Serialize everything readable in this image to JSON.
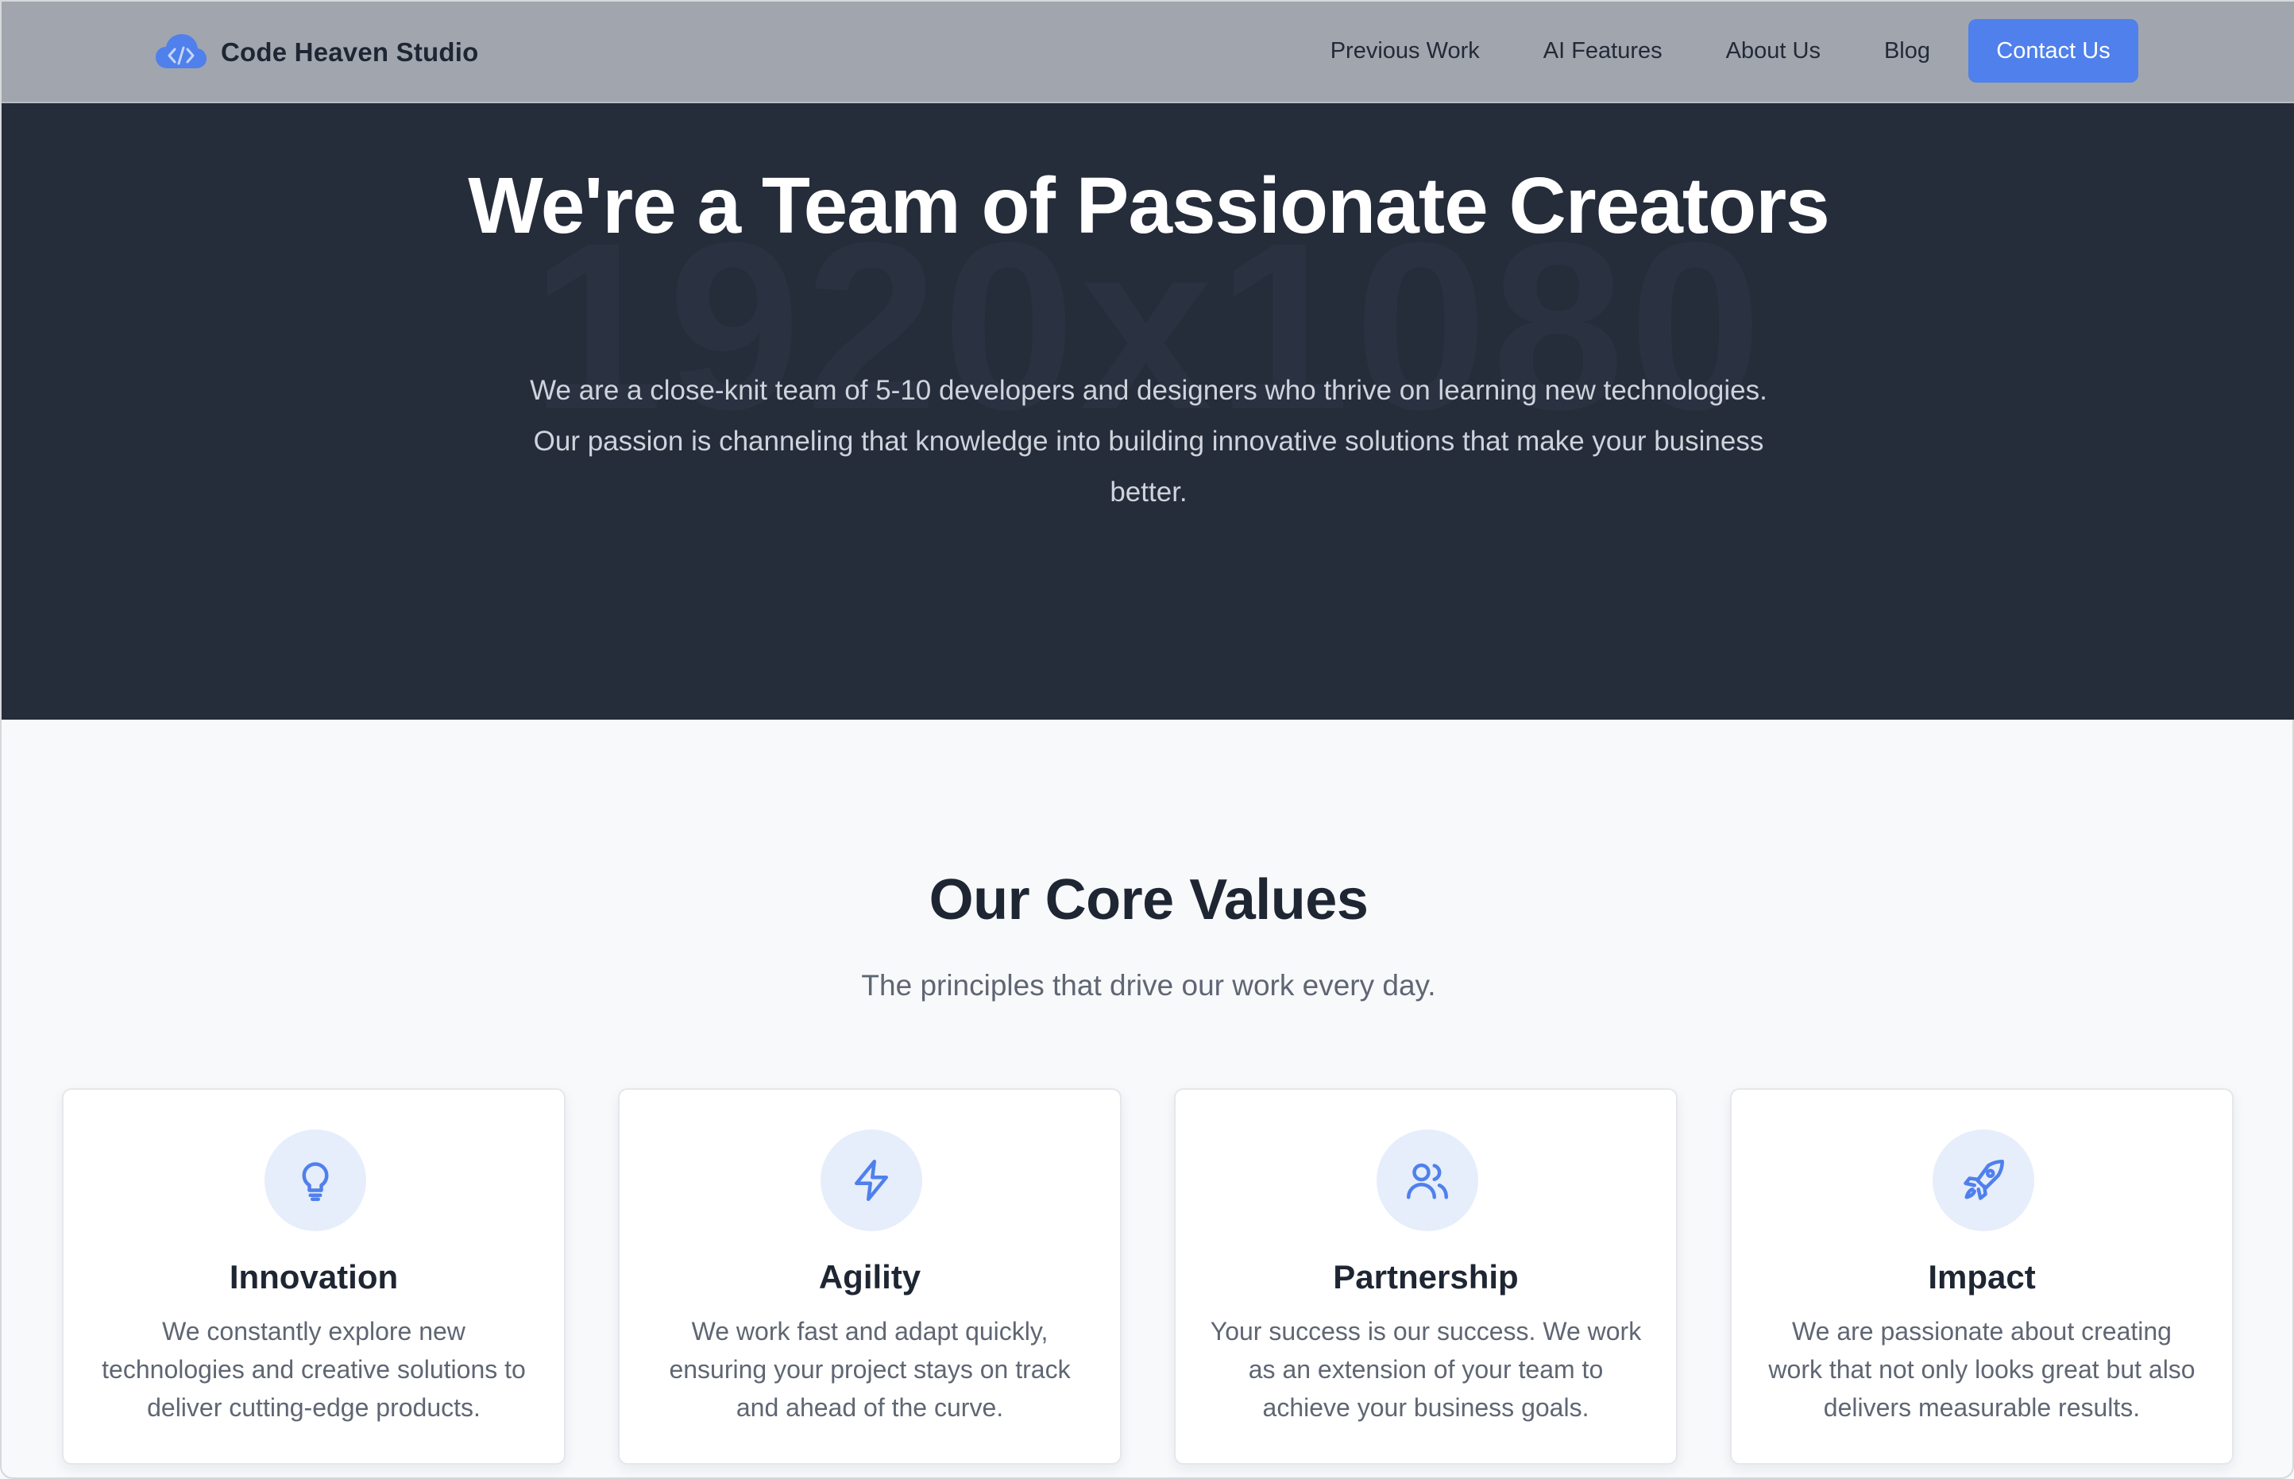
{
  "nav": {
    "brand": "Code Heaven Studio",
    "links": [
      "Previous Work",
      "AI Features",
      "About Us",
      "Blog"
    ],
    "cta": "Contact Us",
    "brand_icon": "cloud-code-icon",
    "accent_color": "#4f80ec"
  },
  "hero": {
    "watermark": "1920x1080",
    "title": "We're a Team of Passionate Creators",
    "subtitle": "We are a close-knit team of 5-10 developers and designers who thrive on learning new technologies. Our passion is channeling that knowledge into building innovative solutions that make your business better."
  },
  "values": {
    "title": "Our Core Values",
    "subtitle": "The principles that drive our work every day.",
    "cards": [
      {
        "icon": "lightbulb-icon",
        "title": "Innovation",
        "description": "We constantly explore new technologies and creative solutions to deliver cutting-edge products."
      },
      {
        "icon": "lightning-icon",
        "title": "Agility",
        "description": "We work fast and adapt quickly, ensuring your project stays on track and ahead of the curve."
      },
      {
        "icon": "users-icon",
        "title": "Partnership",
        "description": "Your success is our success. We work as an extension of your team to achieve your business goals."
      },
      {
        "icon": "rocket-icon",
        "title": "Impact",
        "description": "We are passionate about creating work that not only looks great but also delivers measurable results."
      }
    ]
  }
}
